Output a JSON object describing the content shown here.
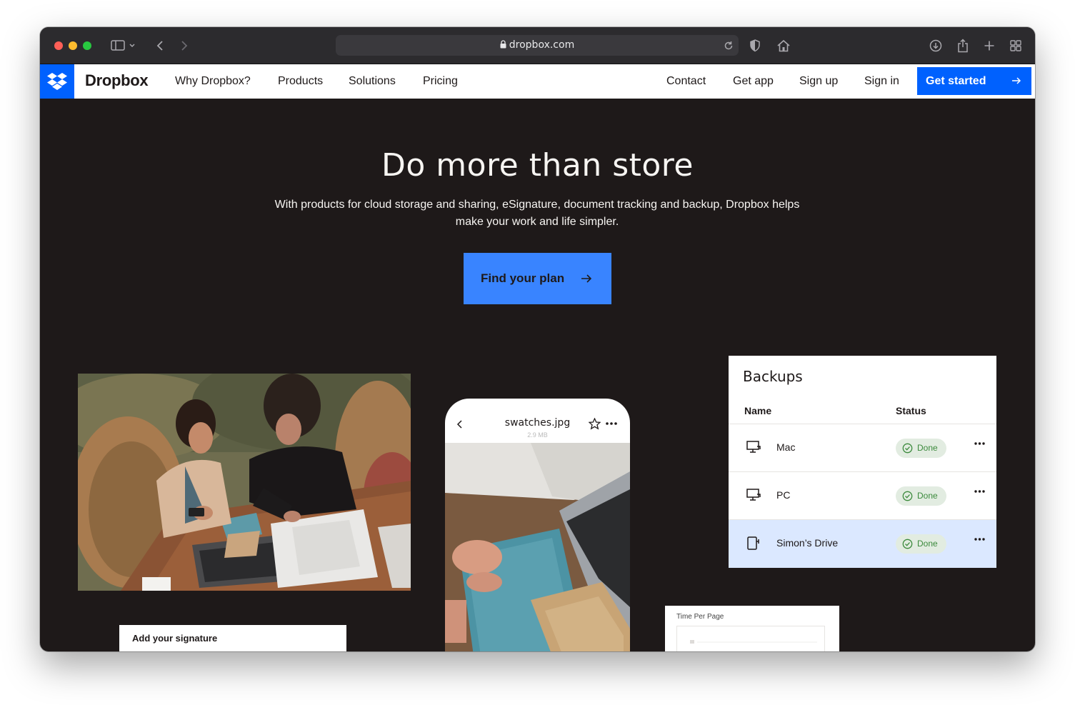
{
  "browser": {
    "url": "dropbox.com"
  },
  "nav": {
    "brand": "Dropbox",
    "links": [
      "Why Dropbox?",
      "Products",
      "Solutions",
      "Pricing"
    ],
    "right_links": [
      "Contact",
      "Get app",
      "Sign up",
      "Sign in"
    ],
    "cta": "Get started"
  },
  "hero": {
    "title": "Do more than store",
    "subtitle_line1": "With products for cloud storage and sharing, eSignature, document tracking and backup, Dropbox helps",
    "subtitle_line2": "make your work and life simpler.",
    "button": "Find your plan"
  },
  "phone": {
    "file_name": "swatches.jpg",
    "file_size": "2.9 MB"
  },
  "backups": {
    "title": "Backups",
    "col_name": "Name",
    "col_status": "Status",
    "rows": [
      {
        "name": "Mac",
        "status": "Done",
        "icon": "desktop-icon"
      },
      {
        "name": "PC",
        "status": "Done",
        "icon": "desktop-icon"
      },
      {
        "name": "Simon’s Drive",
        "status": "Done",
        "icon": "drive-icon"
      }
    ]
  },
  "cards": {
    "signature": "Add your signature",
    "time_per_page": "Time Per Page"
  },
  "colors": {
    "brand_blue": "#0061fe",
    "hero_bg": "#1e1919",
    "button_blue": "#3984ff",
    "selected_row": "#dbe8ff",
    "status_green": "#3c8a3d"
  }
}
